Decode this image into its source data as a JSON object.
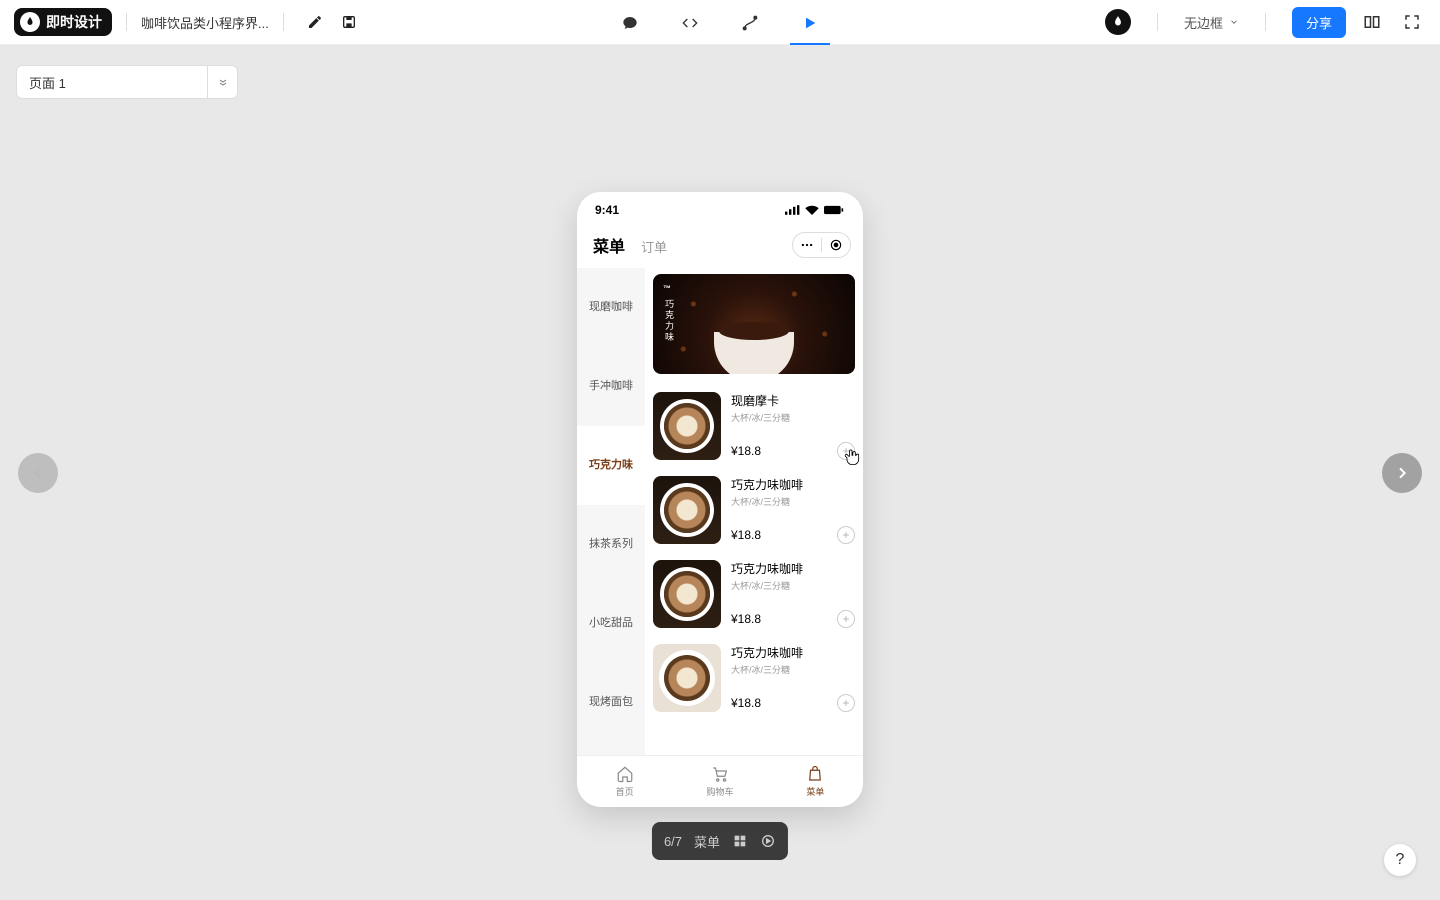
{
  "topbar": {
    "app_name": "即时设计",
    "file_name": "咖啡饮品类小程序界...",
    "frame_label": "无边框",
    "share_label": "分享"
  },
  "page_selector": {
    "label": "页面 1"
  },
  "playbar": {
    "counter": "6/7",
    "name": "菜单"
  },
  "help_label": "?",
  "phone": {
    "time": "9:41",
    "tabs": {
      "menu": "菜单",
      "orders": "订单"
    },
    "hero": {
      "brand": "™",
      "vertical": "巧克力味"
    },
    "categories": [
      {
        "label": "现磨咖啡"
      },
      {
        "label": "手冲咖啡"
      },
      {
        "label": "巧克力味",
        "active": true
      },
      {
        "label": "抹茶系列"
      },
      {
        "label": "小吃甜品"
      },
      {
        "label": "现烤面包"
      }
    ],
    "products": [
      {
        "name": "现磨摩卡",
        "sub": "大杯/冰/三分糖",
        "price": "¥18.8",
        "img": "dark"
      },
      {
        "name": "巧克力味咖啡",
        "sub": "大杯/冰/三分糖",
        "price": "¥18.8",
        "img": "dark"
      },
      {
        "name": "巧克力味咖啡",
        "sub": "大杯/冰/三分糖",
        "price": "¥18.8",
        "img": "dark"
      },
      {
        "name": "巧克力味咖啡",
        "sub": "大杯/冰/三分糖",
        "price": "¥18.8",
        "img": "light"
      }
    ],
    "tabbar": {
      "home": "首页",
      "cart": "购物车",
      "menu": "菜单"
    }
  }
}
